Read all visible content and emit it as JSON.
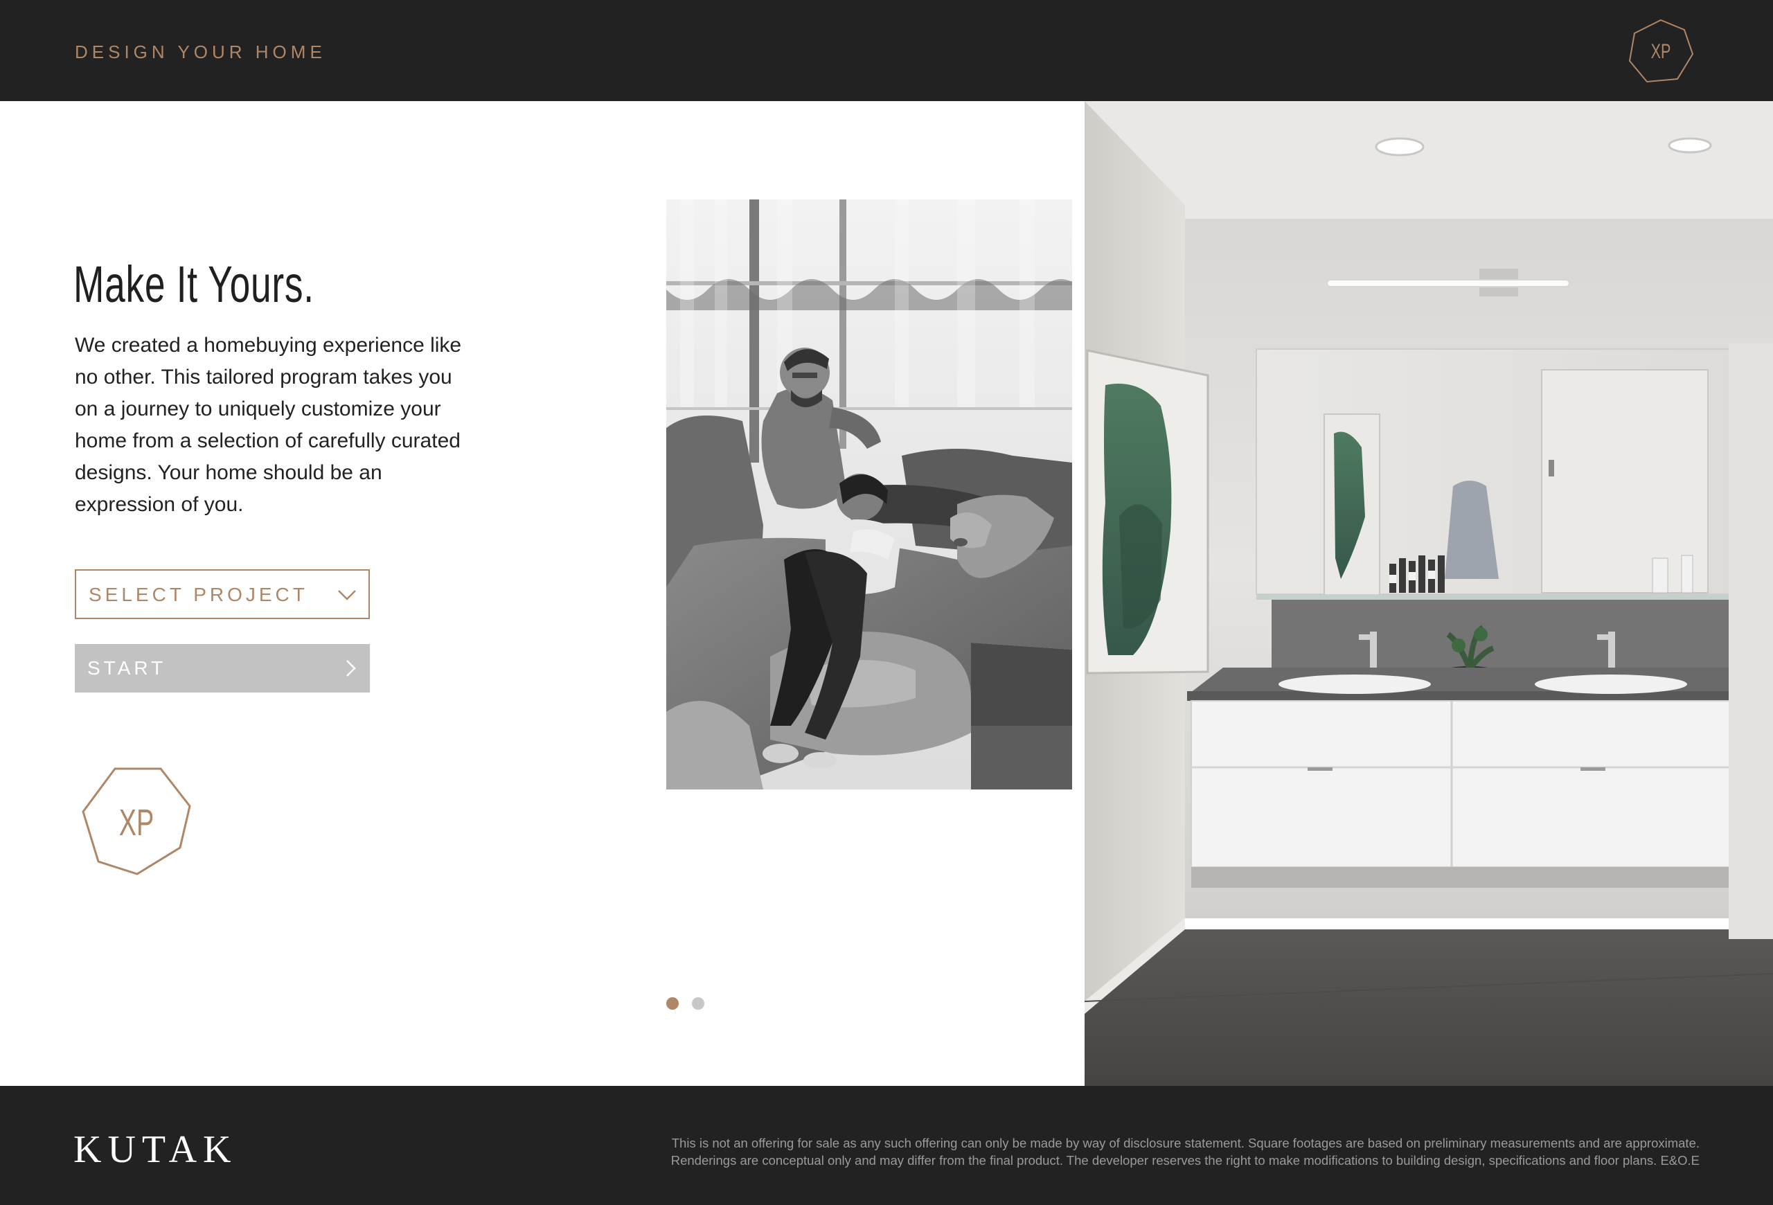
{
  "header": {
    "title": "DESIGN YOUR HOME",
    "logo_text": "XP"
  },
  "main": {
    "headline": "Make It Yours.",
    "intro": "We created a homebuying experience like no other. This tailored program takes you on a journey to uniquely customize your home from a selection of carefully curated designs. Your home should be an expression of you.",
    "select_project": {
      "label": "SELECT PROJECT",
      "icon": "chevron-down-icon"
    },
    "start_button": {
      "label": "START",
      "icon": "chevron-right-icon"
    },
    "badge_text": "XP"
  },
  "carousel": {
    "photo": "couple-on-sofa-with-dog-photo",
    "slide_count": 2,
    "active_index": 0
  },
  "rendering": {
    "photo": "bathroom-vanity-rendering"
  },
  "footer": {
    "brand": "KUTAK",
    "disclaimer_line1": "This is not an offering for sale as any such offering can only be made by way of disclosure statement. Square footages are based on preliminary measurements and are approximate.",
    "disclaimer_line2": "Renderings are conceptual only and may differ from the final product. The developer reserves the right to make modifications to building design, specifications and floor plans. E&O.E"
  },
  "colors": {
    "accent": "#b08766",
    "dark": "#222222",
    "button_gray": "#c2c2c2",
    "dot_inactive": "#c7c7c7"
  }
}
